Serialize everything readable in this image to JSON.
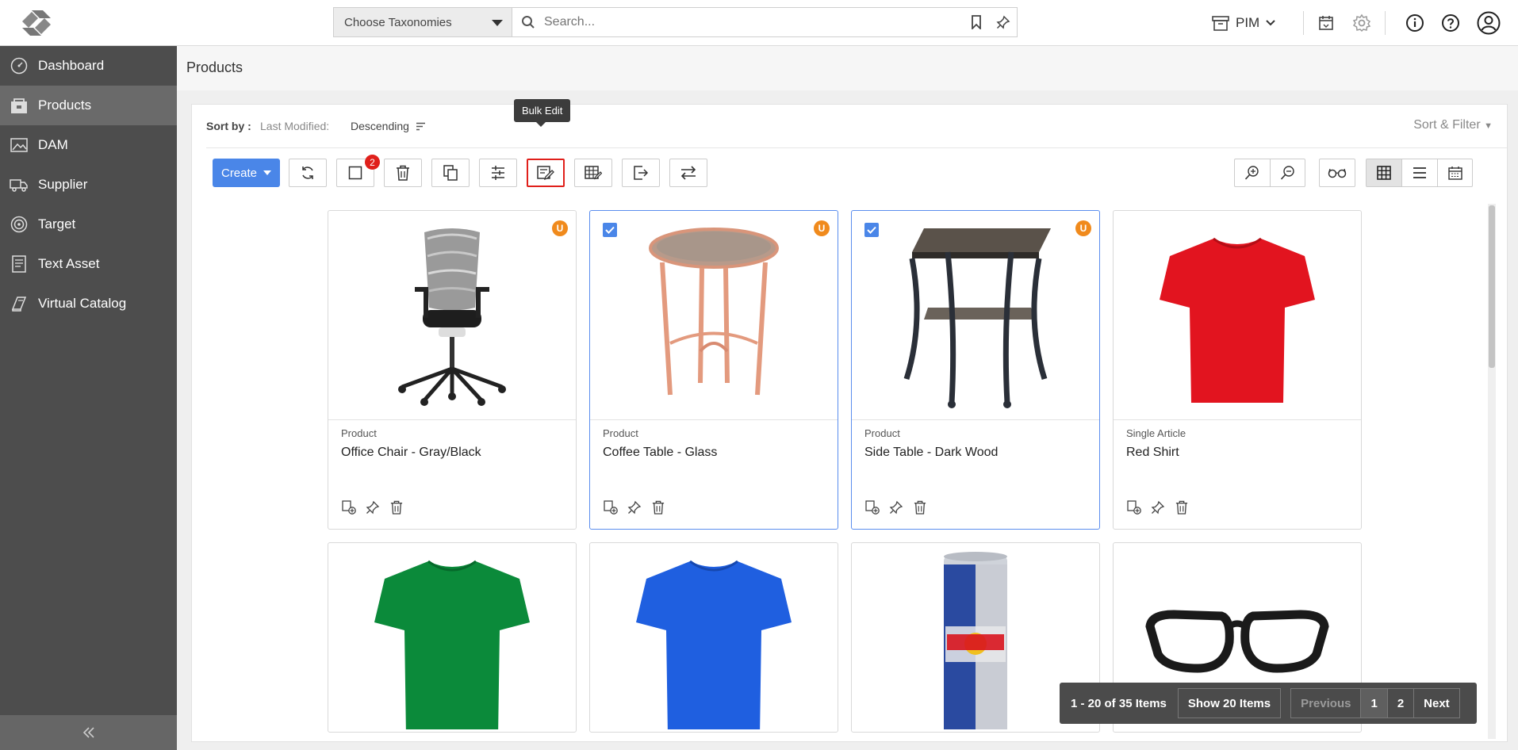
{
  "header": {
    "taxonomy_placeholder": "Choose Taxonomies",
    "search_placeholder": "Search...",
    "module": "PIM"
  },
  "sidebar": {
    "items": [
      {
        "label": "Dashboard",
        "icon": "dashboard-icon"
      },
      {
        "label": "Products",
        "icon": "products-icon"
      },
      {
        "label": "DAM",
        "icon": "dam-icon"
      },
      {
        "label": "Supplier",
        "icon": "supplier-icon"
      },
      {
        "label": "Target",
        "icon": "target-icon"
      },
      {
        "label": "Text Asset",
        "icon": "text-asset-icon"
      },
      {
        "label": "Virtual Catalog",
        "icon": "virtual-catalog-icon"
      }
    ]
  },
  "page": {
    "title": "Products"
  },
  "sort": {
    "label": "Sort by :",
    "field": "Last Modified:",
    "direction": "Descending",
    "filter_label": "Sort & Filter"
  },
  "toolbar": {
    "create_label": "Create",
    "selected_count": "2",
    "tooltip": "Bulk Edit"
  },
  "cards": [
    {
      "type": "Product",
      "name": "Office Chair - Gray/Black",
      "badge": "U",
      "selected": false
    },
    {
      "type": "Product",
      "name": "Coffee Table - Glass",
      "badge": "U",
      "selected": true
    },
    {
      "type": "Product",
      "name": "Side Table - Dark Wood",
      "badge": "U",
      "selected": true
    },
    {
      "type": "Single Article",
      "name": "Red Shirt",
      "badge": "",
      "selected": false
    }
  ],
  "pagination": {
    "info": "1 - 20 of 35 Items",
    "page_size": "Show 20 Items",
    "previous": "Previous",
    "pages": [
      "1",
      "2"
    ],
    "next": "Next"
  },
  "colors": {
    "accent": "#4a86e8",
    "sidebar": "#4d4d4d",
    "badge_orange": "#f08a1c",
    "highlight_red": "#e0201b"
  }
}
